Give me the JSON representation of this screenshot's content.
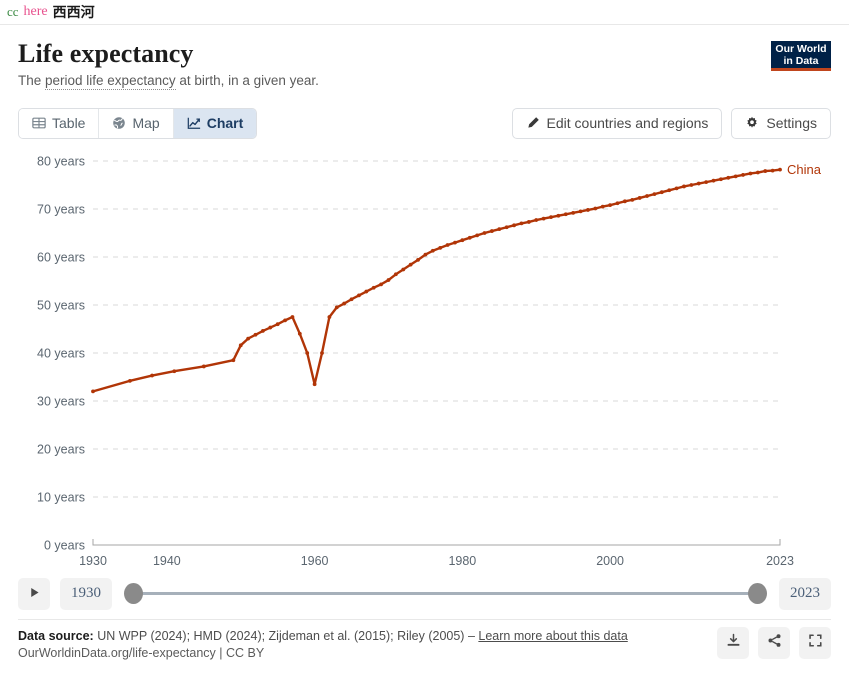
{
  "topbar": {
    "cc": "cc",
    "here": "here",
    "site": "西西河",
    "colors": {
      "cc": "#3d8b45",
      "here": "#e8538f",
      "site": "#1a1a1a"
    }
  },
  "header": {
    "title": "Life expectancy",
    "subtitle_pre": "The ",
    "subtitle_link": "period life expectancy",
    "subtitle_post": " at birth, in a given year.",
    "logo_line1": "Our World",
    "logo_line2": "in Data"
  },
  "tabs": [
    {
      "label": "Table",
      "icon": "table-icon",
      "active": false
    },
    {
      "label": "Map",
      "icon": "globe-icon",
      "active": false
    },
    {
      "label": "Chart",
      "icon": "line-chart-icon",
      "active": true
    }
  ],
  "actions": [
    {
      "label": "Edit countries and regions",
      "icon": "pencil-icon"
    },
    {
      "label": "Settings",
      "icon": "gear-icon"
    }
  ],
  "timeline": {
    "play_label": "▶",
    "start_year": "1930",
    "end_year": "2023"
  },
  "footer": {
    "source_label": "Data source:",
    "source_text": " UN WPP (2024); HMD (2024); Zijdeman et al. (2015); Riley (2005) – ",
    "source_link": "Learn more about this data",
    "url_line": "OurWorldinData.org/life-expectancy | CC BY",
    "buttons": [
      {
        "name": "download-icon"
      },
      {
        "name": "share-icon"
      },
      {
        "name": "fullscreen-icon"
      }
    ]
  },
  "chart_data": {
    "type": "line",
    "title": "Life expectancy",
    "subtitle": "The period life expectancy at birth, in a given year.",
    "xlabel": "",
    "ylabel": "years",
    "xlim": [
      1930,
      2023
    ],
    "ylim": [
      0,
      80
    ],
    "grid": true,
    "ytick_labels": [
      "0 years",
      "10 years",
      "20 years",
      "30 years",
      "40 years",
      "50 years",
      "60 years",
      "70 years",
      "80 years"
    ],
    "ytick_values": [
      0,
      10,
      20,
      30,
      40,
      50,
      60,
      70,
      80
    ],
    "xtick_labels": [
      "1930",
      "1940",
      "1960",
      "1980",
      "2000",
      "2023"
    ],
    "xtick_values": [
      1930,
      1940,
      1960,
      1980,
      2000,
      2023
    ],
    "legend_position": "line-end-right",
    "series": [
      {
        "name": "China",
        "color": "#b13507",
        "x": [
          1930,
          1935,
          1938,
          1941,
          1945,
          1949,
          1950,
          1951,
          1952,
          1953,
          1954,
          1955,
          1956,
          1957,
          1958,
          1959,
          1960,
          1961,
          1962,
          1963,
          1964,
          1965,
          1966,
          1967,
          1968,
          1969,
          1970,
          1971,
          1972,
          1973,
          1974,
          1975,
          1976,
          1977,
          1978,
          1979,
          1980,
          1981,
          1982,
          1983,
          1984,
          1985,
          1986,
          1987,
          1988,
          1989,
          1990,
          1991,
          1992,
          1993,
          1994,
          1995,
          1996,
          1997,
          1998,
          1999,
          2000,
          2001,
          2002,
          2003,
          2004,
          2005,
          2006,
          2007,
          2008,
          2009,
          2010,
          2011,
          2012,
          2013,
          2014,
          2015,
          2016,
          2017,
          2018,
          2019,
          2020,
          2021,
          2022,
          2023
        ],
        "y": [
          32.0,
          34.2,
          35.3,
          36.2,
          37.2,
          38.5,
          41.6,
          43.0,
          43.8,
          44.6,
          45.3,
          46.0,
          46.8,
          47.5,
          44.0,
          40.0,
          33.5,
          40.0,
          47.5,
          49.5,
          50.3,
          51.2,
          52.0,
          52.8,
          53.6,
          54.3,
          55.2,
          56.4,
          57.4,
          58.4,
          59.4,
          60.5,
          61.3,
          61.9,
          62.5,
          63.0,
          63.5,
          64.0,
          64.5,
          65.0,
          65.4,
          65.8,
          66.2,
          66.6,
          67.0,
          67.3,
          67.7,
          68.0,
          68.3,
          68.6,
          68.9,
          69.2,
          69.5,
          69.8,
          70.1,
          70.5,
          70.8,
          71.2,
          71.6,
          71.9,
          72.3,
          72.7,
          73.1,
          73.5,
          73.9,
          74.3,
          74.7,
          75.0,
          75.3,
          75.6,
          75.9,
          76.2,
          76.5,
          76.8,
          77.1,
          77.4,
          77.6,
          77.9,
          78.0,
          78.2
        ]
      }
    ]
  }
}
